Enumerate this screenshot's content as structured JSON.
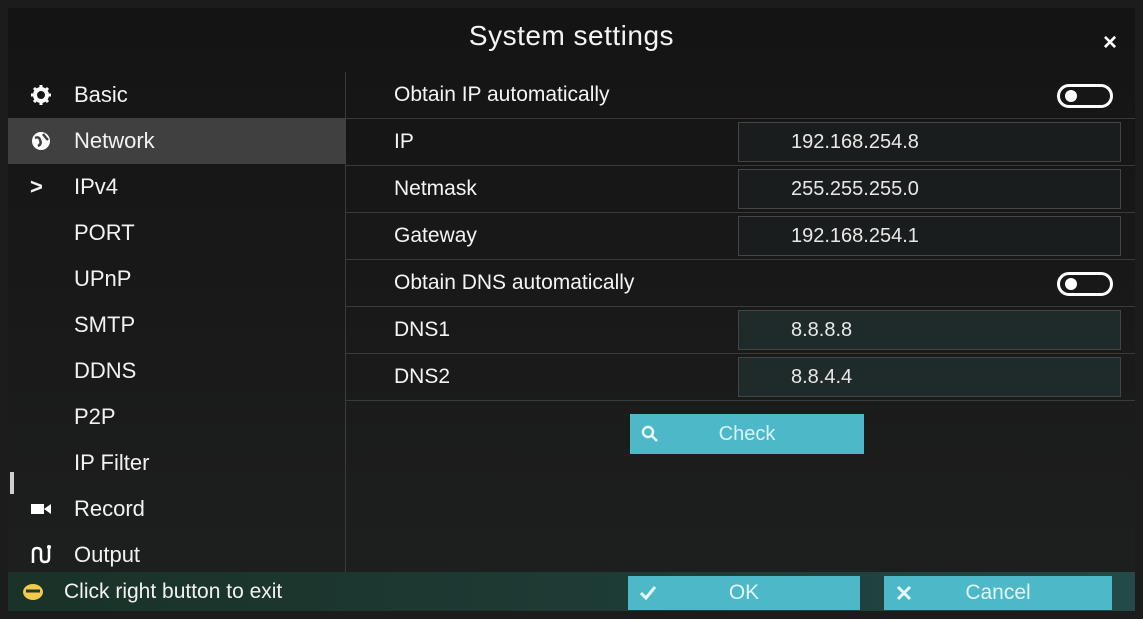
{
  "window": {
    "title": "System settings",
    "close_label": "×"
  },
  "sidebar": {
    "items": [
      {
        "label": "Basic",
        "icon": "gear-icon"
      },
      {
        "label": "Network",
        "icon": "globe-icon",
        "active": true
      },
      {
        "label": "IPv4",
        "icon": "chevron-right-icon",
        "selected": true
      },
      {
        "label": "PORT"
      },
      {
        "label": "UPnP"
      },
      {
        "label": "SMTP"
      },
      {
        "label": "DDNS"
      },
      {
        "label": "P2P"
      },
      {
        "label": "IP Filter"
      },
      {
        "label": "Record",
        "icon": "camera-icon"
      },
      {
        "label": "Output",
        "icon": "output-icon"
      }
    ]
  },
  "network": {
    "obtain_ip_label": "Obtain IP automatically",
    "obtain_ip_enabled": false,
    "ip_label": "IP",
    "ip_value": "192.168.254.8",
    "netmask_label": "Netmask",
    "netmask_value": "255.255.255.0",
    "gateway_label": "Gateway",
    "gateway_value": "192.168.254.1",
    "obtain_dns_label": "Obtain DNS automatically",
    "obtain_dns_enabled": false,
    "dns1_label": "DNS1",
    "dns1_value": "8.8.8.8",
    "dns2_label": "DNS2",
    "dns2_value": "8.8.4.4",
    "check_label": "Check"
  },
  "footer": {
    "hint": "Click right button to exit",
    "ok_label": "OK",
    "cancel_label": "Cancel"
  },
  "colors": {
    "accent": "#4db8c8",
    "active_item": "#404040",
    "footer": "#1d3a34"
  }
}
